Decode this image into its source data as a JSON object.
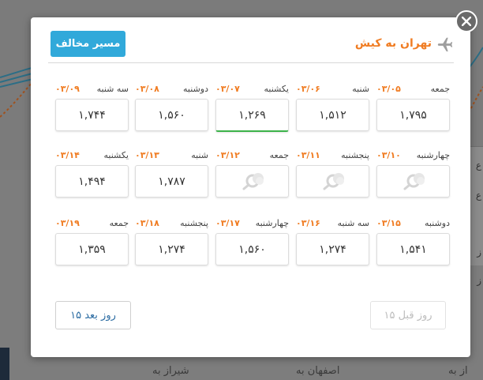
{
  "modal": {
    "route_title": "تهران به کیش",
    "reverse_route_label": "مسیر مخالف",
    "next_days_label": "۱۵ روز بعد",
    "prev_days_label": "۱۵ روز قبل",
    "accent_color": "#f07c22",
    "button_color": "#31a9da",
    "selected_color": "#3cb34a"
  },
  "days": [
    {
      "name": "جمعه",
      "date": "۰۳/۰۵",
      "price": "۱,۷۹۵"
    },
    {
      "name": "شنبه",
      "date": "۰۳/۰۶",
      "price": "۱,۵۱۲"
    },
    {
      "name": "یکشنبه",
      "date": "۰۳/۰۷",
      "price": "۱,۲۶۹",
      "selected": true
    },
    {
      "name": "دوشنبه",
      "date": "۰۳/۰۸",
      "price": "۱,۵۶۰"
    },
    {
      "name": "سه شنبه",
      "date": "۰۳/۰۹",
      "price": "۱,۷۴۴"
    },
    {
      "name": "چهارشنبه",
      "date": "۰۳/۱۰",
      "price": null
    },
    {
      "name": "پنجشنبه",
      "date": "۰۳/۱۱",
      "price": null
    },
    {
      "name": "جمعه",
      "date": "۰۳/۱۲",
      "price": null
    },
    {
      "name": "شنبه",
      "date": "۰۳/۱۳",
      "price": "۱,۷۸۷"
    },
    {
      "name": "یکشنبه",
      "date": "۰۳/۱۴",
      "price": "۱,۴۹۴"
    },
    {
      "name": "دوشنبه",
      "date": "۰۳/۱۵",
      "price": "۱,۵۴۱"
    },
    {
      "name": "سه شنبه",
      "date": "۰۳/۱۶",
      "price": "۱,۲۷۴"
    },
    {
      "name": "چهارشنبه",
      "date": "۰۳/۱۷",
      "price": "۱,۵۶۰"
    },
    {
      "name": "پنجشنبه",
      "date": "۰۳/۱۸",
      "price": "۱,۲۷۴"
    },
    {
      "name": "جمعه",
      "date": "۰۳/۱۹",
      "price": "۱,۳۵۹"
    }
  ],
  "background": {
    "bottom_texts": [
      "شیراز به",
      "اصفهان به",
      "از به"
    ],
    "right_texts": [
      "ع",
      "ع",
      "ز",
      "ز"
    ]
  },
  "icons": {
    "close": "close-icon",
    "plane": "plane-icon",
    "no_flight": "search-icon"
  }
}
